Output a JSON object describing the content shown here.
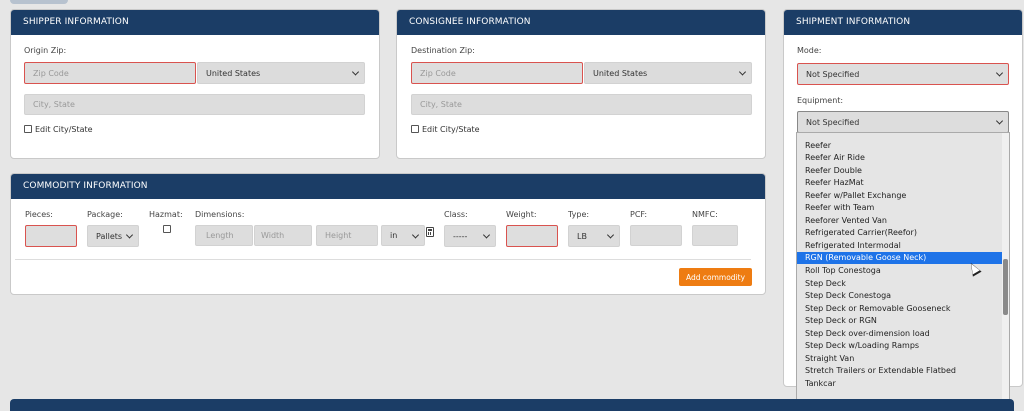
{
  "shipper": {
    "title": "SHIPPER INFORMATION",
    "origin_label": "Origin Zip:",
    "zip_placeholder": "Zip Code",
    "country": "United States",
    "city_placeholder": "City, State",
    "edit_label": "Edit City/State"
  },
  "consignee": {
    "title": "CONSIGNEE INFORMATION",
    "dest_label": "Destination Zip:",
    "zip_placeholder": "Zip Code",
    "country": "United States",
    "city_placeholder": "City, State",
    "edit_label": "Edit City/State"
  },
  "shipment": {
    "title": "SHIPMENT INFORMATION",
    "mode_label": "Mode:",
    "mode_value": "Not Specified",
    "equipment_label": "Equipment:",
    "equipment_value": "Not Specified",
    "equipment_options": [
      "Reefer",
      "Reefer Air Ride",
      "Reefer Double",
      "Reefer HazMat",
      "Reefer w/Pallet Exchange",
      "Reefer with Team",
      "Reeforer Vented Van",
      "Refrigerated Carrier(Reefor)",
      "Refrigerated Intermodal",
      "RGN (Removable Goose Neck)",
      "Roll Top Conestoga",
      "Step Deck",
      "Step Deck Conestoga",
      "Step Deck or Removable Gooseneck",
      "Step Deck or RGN",
      "Step Deck over-dimension load",
      "Step Deck w/Loading Ramps",
      "Straight Van",
      "Stretch Trailers or Extendable Flatbed",
      "Tankcar"
    ],
    "selected_option": "RGN (Removable Goose Neck)"
  },
  "commodity": {
    "title": "COMMODITY INFORMATION",
    "pieces_label": "Pieces:",
    "package_label": "Package:",
    "package_value": "Pallets",
    "hazmat_label": "Hazmat:",
    "dimensions_label": "Dimensions:",
    "length_placeholder": "Length",
    "width_placeholder": "Width",
    "height_placeholder": "Height",
    "unit_value": "in",
    "class_label": "Class:",
    "class_value": "-----",
    "weight_label": "Weight:",
    "type_label": "Type:",
    "type_value": "LB",
    "pcf_label": "PCF:",
    "nmfc_label": "NMFC:",
    "add_button": "Add commodity"
  },
  "colors": {
    "header_bg": "#1b3d66",
    "accent_orange": "#ee7c12",
    "error_red": "#d9534f",
    "selection_blue": "#1e73e8"
  }
}
